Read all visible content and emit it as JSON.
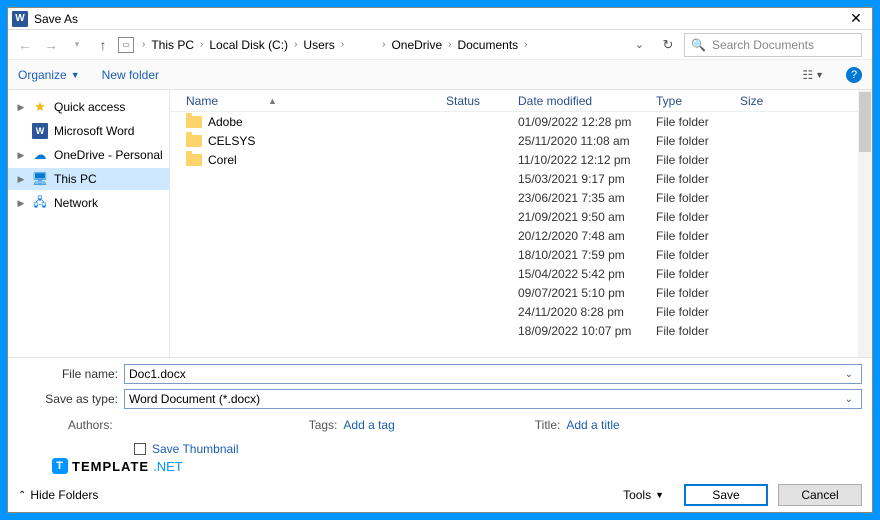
{
  "title": "Save As",
  "breadcrumb": [
    "This PC",
    "Local Disk (C:)",
    "Users",
    "",
    "OneDrive",
    "Documents"
  ],
  "search_placeholder": "Search Documents",
  "toolbar": {
    "organize": "Organize",
    "new_folder": "New folder"
  },
  "sidebar": [
    {
      "label": "Quick access",
      "icon": "star",
      "caret": "▶"
    },
    {
      "label": "Microsoft Word",
      "icon": "word",
      "caret": ""
    },
    {
      "label": "OneDrive - Personal",
      "icon": "cloud",
      "caret": "▶"
    },
    {
      "label": "This PC",
      "icon": "pc",
      "caret": "▶",
      "selected": true
    },
    {
      "label": "Network",
      "icon": "net",
      "caret": "▶"
    }
  ],
  "columns": {
    "name": "Name",
    "status": "Status",
    "date": "Date modified",
    "type": "Type",
    "size": "Size"
  },
  "rows": [
    {
      "name": "Adobe",
      "date": "01/09/2022 12:28 pm",
      "type": "File folder"
    },
    {
      "name": "CELSYS",
      "date": "25/11/2020 11:08 am",
      "type": "File folder"
    },
    {
      "name": "Corel",
      "date": "11/10/2022 12:12 pm",
      "type": "File folder"
    },
    {
      "name": "",
      "date": "15/03/2021 9:17 pm",
      "type": "File folder"
    },
    {
      "name": "",
      "date": "23/06/2021 7:35 am",
      "type": "File folder"
    },
    {
      "name": "",
      "date": "21/09/2021 9:50 am",
      "type": "File folder"
    },
    {
      "name": "",
      "date": "20/12/2020 7:48 am",
      "type": "File folder"
    },
    {
      "name": "",
      "date": "18/10/2021 7:59 pm",
      "type": "File folder"
    },
    {
      "name": "",
      "date": "15/04/2022 5:42 pm",
      "type": "File folder"
    },
    {
      "name": "",
      "date": "09/07/2021 5:10 pm",
      "type": "File folder"
    },
    {
      "name": "",
      "date": "24/11/2020 8:28 pm",
      "type": "File folder"
    },
    {
      "name": "",
      "date": "18/09/2022 10:07 pm",
      "type": "File folder"
    }
  ],
  "file_name_label": "File name:",
  "file_name_value": "Doc1.docx",
  "save_type_label": "Save as type:",
  "save_type_value": "Word Document (*.docx)",
  "meta": {
    "authors_label": "Authors:",
    "authors_value": "",
    "tags_label": "Tags:",
    "tags_value": "Add a tag",
    "title_label": "Title:",
    "title_value": "Add a title"
  },
  "save_thumbnail": "Save Thumbnail",
  "logo_text": "TEMPLATE",
  "logo_suffix": ".NET",
  "hide_folders": "Hide Folders",
  "tools": "Tools",
  "save": "Save",
  "cancel": "Cancel"
}
